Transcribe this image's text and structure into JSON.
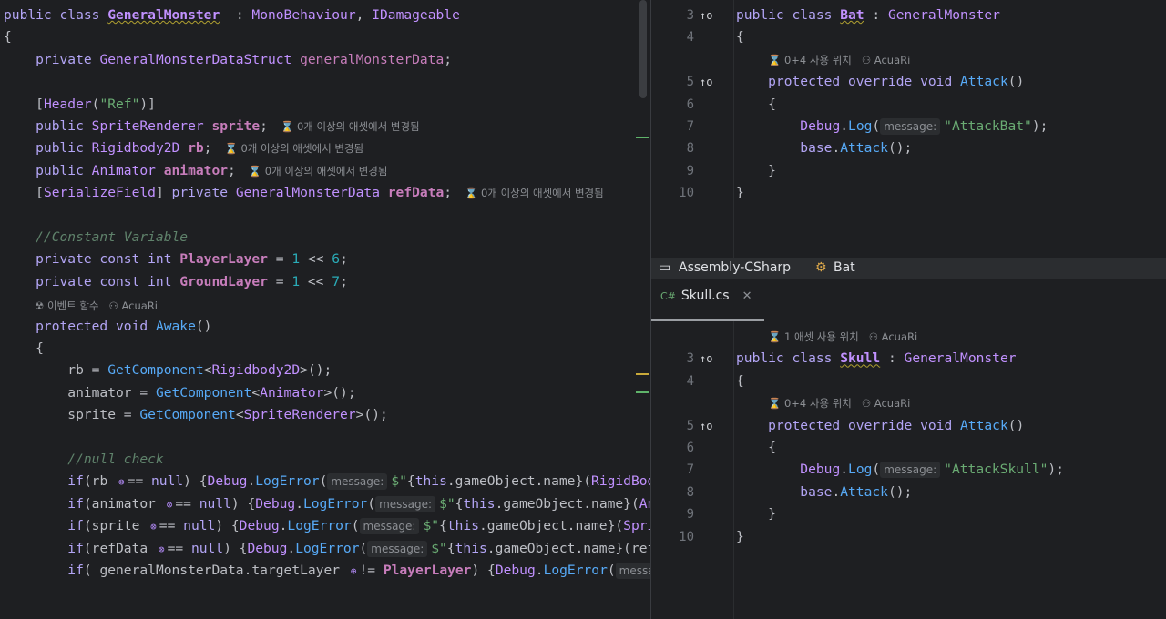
{
  "left": {
    "lines": [
      {
        "segs": [
          [
            "kw2",
            "public class "
          ],
          [
            "cls bold und",
            "GeneralMonster"
          ],
          [
            "",
            "  : "
          ],
          [
            "cls",
            "MonoBehaviour"
          ],
          [
            "",
            ", "
          ],
          [
            "cls",
            "IDamageable"
          ]
        ]
      },
      {
        "segs": [
          [
            "",
            "{"
          ]
        ]
      },
      {
        "segs": [
          [
            "kw2",
            "    private "
          ],
          [
            "cls",
            "GeneralMonsterDataStruct "
          ],
          [
            "fld",
            "generalMonsterData"
          ],
          [
            "",
            ";"
          ]
        ]
      },
      {
        "segs": [
          [
            "",
            ""
          ]
        ]
      },
      {
        "segs": [
          [
            "",
            "    ["
          ],
          [
            "cls",
            "Header"
          ],
          [
            "",
            "("
          ],
          [
            "str",
            "\"Ref\""
          ],
          [
            "",
            ")]"
          ]
        ]
      },
      {
        "segs": [
          [
            "kw2",
            "    public "
          ],
          [
            "cls",
            "SpriteRenderer "
          ],
          [
            "fld bold",
            "sprite"
          ],
          [
            "",
            ";"
          ]
        ],
        "hint": "⌛ 0개 이상의 애셋에서 변경됨"
      },
      {
        "segs": [
          [
            "kw2",
            "    public "
          ],
          [
            "cls",
            "Rigidbody2D "
          ],
          [
            "fld bold",
            "rb"
          ],
          [
            "",
            ";"
          ]
        ],
        "hint": "⌛ 0개 이상의 애셋에서 변경됨"
      },
      {
        "segs": [
          [
            "kw2",
            "    public "
          ],
          [
            "cls",
            "Animator "
          ],
          [
            "fld bold",
            "animator"
          ],
          [
            "",
            ";"
          ]
        ],
        "hint": "⌛ 0개 이상의 애셋에서 변경됨"
      },
      {
        "segs": [
          [
            "",
            "    ["
          ],
          [
            "cls",
            "SerializeField"
          ],
          [
            "",
            "] "
          ],
          [
            "kw2",
            "private "
          ],
          [
            "cls",
            "GeneralMonsterData "
          ],
          [
            "fld bold",
            "refData"
          ],
          [
            "",
            ";"
          ]
        ],
        "hint": "⌛ 0개 이상의 애셋에서 변경됨"
      },
      {
        "segs": [
          [
            "",
            ""
          ]
        ]
      },
      {
        "segs": [
          [
            "cm",
            "    //Constant Variable"
          ]
        ]
      },
      {
        "segs": [
          [
            "kw2",
            "    private const int "
          ],
          [
            "fld bold",
            "PlayerLayer"
          ],
          [
            "",
            " = "
          ],
          [
            "num",
            "1"
          ],
          [
            "",
            " << "
          ],
          [
            "num",
            "6"
          ],
          [
            "",
            ";"
          ]
        ]
      },
      {
        "segs": [
          [
            "kw2",
            "    private const int "
          ],
          [
            "fld bold",
            "GroundLayer"
          ],
          [
            "",
            " = "
          ],
          [
            "num",
            "1"
          ],
          [
            "",
            " << "
          ],
          [
            "num",
            "7"
          ],
          [
            "",
            ";"
          ]
        ]
      }
    ],
    "hint_awake": "☢ 이벤트 함수   ⚇ AcuaRi",
    "lines2": [
      {
        "segs": [
          [
            "kw2",
            "    protected void "
          ],
          [
            "mth",
            "Awake"
          ],
          [
            "",
            "()"
          ]
        ]
      },
      {
        "segs": [
          [
            "",
            "    {"
          ]
        ]
      },
      {
        "segs": [
          [
            "",
            "        rb = "
          ],
          [
            "mth",
            "GetComponent"
          ],
          [
            "",
            "<"
          ],
          [
            "cls",
            "Rigidbody2D"
          ],
          [
            "",
            ">();"
          ]
        ]
      },
      {
        "segs": [
          [
            "",
            "        animator = "
          ],
          [
            "mth",
            "GetComponent"
          ],
          [
            "",
            "<"
          ],
          [
            "cls",
            "Animator"
          ],
          [
            "",
            ">();"
          ]
        ]
      },
      {
        "segs": [
          [
            "",
            "        sprite = "
          ],
          [
            "mth",
            "GetComponent"
          ],
          [
            "",
            "<"
          ],
          [
            "cls",
            "SpriteRenderer"
          ],
          [
            "",
            ">();"
          ]
        ]
      },
      {
        "segs": [
          [
            "",
            ""
          ]
        ]
      },
      {
        "segs": [
          [
            "cm",
            "        //null check"
          ]
        ]
      },
      {
        "segs": [
          [
            "kw2",
            "        if"
          ],
          [
            "",
            "(rb "
          ],
          [
            "chip",
            "⊗"
          ],
          [
            "",
            "== "
          ],
          [
            "kw2",
            "null"
          ],
          [
            "",
            ") {"
          ],
          [
            "cls",
            "Debug"
          ],
          [
            "",
            "."
          ],
          [
            "mth",
            "LogError"
          ],
          [
            "",
            "("
          ],
          [
            "ph",
            "message:"
          ],
          [
            "str",
            "$\""
          ],
          [
            "",
            "{"
          ],
          [
            "kw2",
            "this"
          ],
          [
            "",
            ".gameObject.name}("
          ],
          [
            "cls",
            "RigidBod"
          ]
        ]
      },
      {
        "segs": [
          [
            "kw2",
            "        if"
          ],
          [
            "",
            "(animator "
          ],
          [
            "chip",
            "⊗"
          ],
          [
            "",
            "== "
          ],
          [
            "kw2",
            "null"
          ],
          [
            "",
            ") {"
          ],
          [
            "cls",
            "Debug"
          ],
          [
            "",
            "."
          ],
          [
            "mth",
            "LogError"
          ],
          [
            "",
            "("
          ],
          [
            "ph",
            "message:"
          ],
          [
            "str",
            "$\""
          ],
          [
            "",
            "{"
          ],
          [
            "kw2",
            "this"
          ],
          [
            "",
            ".gameObject.name}("
          ],
          [
            "cls",
            "An"
          ]
        ]
      },
      {
        "segs": [
          [
            "kw2",
            "        if"
          ],
          [
            "",
            "(sprite "
          ],
          [
            "chip",
            "⊗"
          ],
          [
            "",
            "== "
          ],
          [
            "kw2",
            "null"
          ],
          [
            "",
            ") {"
          ],
          [
            "cls",
            "Debug"
          ],
          [
            "",
            "."
          ],
          [
            "mth",
            "LogError"
          ],
          [
            "",
            "("
          ],
          [
            "ph",
            "message:"
          ],
          [
            "str",
            "$\""
          ],
          [
            "",
            "{"
          ],
          [
            "kw2",
            "this"
          ],
          [
            "",
            ".gameObject.name}("
          ],
          [
            "cls",
            "Spri"
          ]
        ]
      },
      {
        "segs": [
          [
            "kw2",
            "        if"
          ],
          [
            "",
            "(refData "
          ],
          [
            "chip",
            "⊗"
          ],
          [
            "",
            "== "
          ],
          [
            "kw2",
            "null"
          ],
          [
            "",
            ") {"
          ],
          [
            "cls",
            "Debug"
          ],
          [
            "",
            "."
          ],
          [
            "mth",
            "LogError"
          ],
          [
            "",
            "("
          ],
          [
            "ph",
            "message:"
          ],
          [
            "str",
            "$\""
          ],
          [
            "",
            "{"
          ],
          [
            "kw2",
            "this"
          ],
          [
            "",
            ".gameObject.name}(ref"
          ]
        ]
      },
      {
        "segs": [
          [
            "kw2",
            "        if"
          ],
          [
            "",
            "( generalMonsterData.targetLayer "
          ],
          [
            "chip",
            "⊕"
          ],
          [
            "",
            "!= "
          ],
          [
            "fld bold",
            "PlayerLayer"
          ],
          [
            "",
            ") {"
          ],
          [
            "cls",
            "Debug"
          ],
          [
            "",
            "."
          ],
          [
            "mth",
            "LogError"
          ],
          [
            "",
            "("
          ],
          [
            "ph",
            "messa"
          ]
        ]
      }
    ]
  },
  "right_top": {
    "rows": [
      {
        "n": "3",
        "g": "↑o",
        "segs": [
          [
            "kw2",
            "public class "
          ],
          [
            "cls bold und",
            "Bat"
          ],
          [
            "",
            " : "
          ],
          [
            "cls",
            "GeneralMonster"
          ]
        ]
      },
      {
        "n": "4",
        "segs": [
          [
            "",
            "{"
          ]
        ]
      },
      {
        "hint": "⌛ 0+4 사용 위치   ⚇ AcuaRi"
      },
      {
        "n": "5",
        "g": "↑o",
        "segs": [
          [
            "kw2",
            "    protected override void "
          ],
          [
            "mth",
            "Attack"
          ],
          [
            "",
            "()"
          ]
        ]
      },
      {
        "n": "6",
        "segs": [
          [
            "",
            "    {"
          ]
        ]
      },
      {
        "n": "7",
        "segs": [
          [
            "",
            "        "
          ],
          [
            "cls",
            "Debug"
          ],
          [
            "",
            "."
          ],
          [
            "mth",
            "Log"
          ],
          [
            "",
            "("
          ],
          [
            "ph",
            "message:"
          ],
          [
            "str",
            "\"AttackBat\""
          ],
          [
            "",
            ");"
          ]
        ]
      },
      {
        "n": "8",
        "segs": [
          [
            "kw2",
            "        base"
          ],
          [
            "",
            "."
          ],
          [
            "mth",
            "Attack"
          ],
          [
            "",
            "();"
          ]
        ]
      },
      {
        "n": "9",
        "segs": [
          [
            "",
            "    }"
          ]
        ]
      },
      {
        "n": "10",
        "segs": [
          [
            "",
            "}"
          ]
        ]
      }
    ]
  },
  "breadcrumb": {
    "project": "Assembly-CSharp",
    "class": "Bat"
  },
  "tab": {
    "lang": "C#",
    "file": "Skull.cs",
    "close": "✕"
  },
  "right_bottom": {
    "rows": [
      {
        "hint": "⌛ 1 애셋 사용 위치   ⚇ AcuaRi"
      },
      {
        "n": "3",
        "g": "↑o",
        "segs": [
          [
            "kw2",
            "public class "
          ],
          [
            "cls bold und",
            "Skull"
          ],
          [
            "",
            " : "
          ],
          [
            "cls",
            "GeneralMonster"
          ]
        ]
      },
      {
        "n": "4",
        "segs": [
          [
            "",
            "{"
          ]
        ]
      },
      {
        "hint": "⌛ 0+4 사용 위치   ⚇ AcuaRi"
      },
      {
        "n": "5",
        "g": "↑o",
        "segs": [
          [
            "kw2",
            "    protected override void "
          ],
          [
            "mth",
            "Attack"
          ],
          [
            "",
            "()"
          ]
        ]
      },
      {
        "n": "6",
        "segs": [
          [
            "",
            "    {"
          ]
        ]
      },
      {
        "n": "7",
        "segs": [
          [
            "",
            "        "
          ],
          [
            "cls",
            "Debug"
          ],
          [
            "",
            "."
          ],
          [
            "mth",
            "Log"
          ],
          [
            "",
            "("
          ],
          [
            "ph",
            "message:"
          ],
          [
            "str",
            "\"AttackSkull\""
          ],
          [
            "",
            ");"
          ]
        ]
      },
      {
        "n": "8",
        "segs": [
          [
            "kw2",
            "        base"
          ],
          [
            "",
            "."
          ],
          [
            "mth",
            "Attack"
          ],
          [
            "",
            "();"
          ]
        ]
      },
      {
        "n": "9",
        "segs": [
          [
            "",
            "    }"
          ]
        ]
      },
      {
        "n": "10",
        "segs": [
          [
            "",
            "}"
          ]
        ]
      }
    ]
  }
}
